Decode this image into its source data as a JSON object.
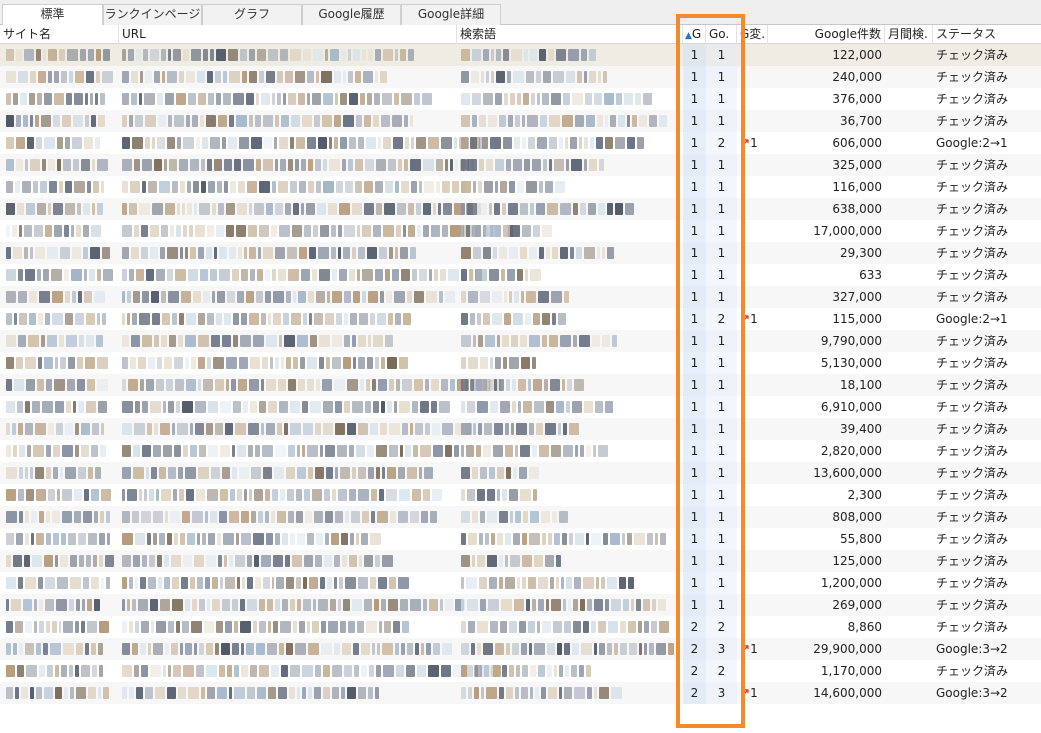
{
  "tabs": [
    {
      "label": "標準",
      "active": true
    },
    {
      "label": "ランクインページ",
      "active": false
    },
    {
      "label": "グラフ",
      "active": false
    },
    {
      "label": "Google履歴",
      "active": false
    },
    {
      "label": "Google詳細",
      "active": false
    }
  ],
  "columns": {
    "site_name": "サイト名",
    "url": "URL",
    "keyword": "検索語",
    "g": "G",
    "go": "Go.",
    "change": "G変.",
    "google_count": "Google件数",
    "monthly": "月間検.",
    "status": "ステータス"
  },
  "sort_icon": "sort-ascending-icon",
  "highlight_color": "#f28a2e",
  "rows": [
    {
      "g": "1",
      "go": "1",
      "chg": "",
      "count": "122,000",
      "status": "チェック済み"
    },
    {
      "g": "1",
      "go": "1",
      "chg": "",
      "count": "240,000",
      "status": "チェック済み"
    },
    {
      "g": "1",
      "go": "1",
      "chg": "",
      "count": "376,000",
      "status": "チェック済み"
    },
    {
      "g": "1",
      "go": "1",
      "chg": "",
      "count": "36,700",
      "status": "チェック済み"
    },
    {
      "g": "1",
      "go": "2",
      "chg": "1",
      "count": "606,000",
      "status": "Google:2→1"
    },
    {
      "g": "1",
      "go": "1",
      "chg": "",
      "count": "325,000",
      "status": "チェック済み"
    },
    {
      "g": "1",
      "go": "1",
      "chg": "",
      "count": "116,000",
      "status": "チェック済み"
    },
    {
      "g": "1",
      "go": "1",
      "chg": "",
      "count": "638,000",
      "status": "チェック済み"
    },
    {
      "g": "1",
      "go": "1",
      "chg": "",
      "count": "17,000,000",
      "status": "チェック済み"
    },
    {
      "g": "1",
      "go": "1",
      "chg": "",
      "count": "29,300",
      "status": "チェック済み"
    },
    {
      "g": "1",
      "go": "1",
      "chg": "",
      "count": "633",
      "status": "チェック済み"
    },
    {
      "g": "1",
      "go": "1",
      "chg": "",
      "count": "327,000",
      "status": "チェック済み"
    },
    {
      "g": "1",
      "go": "2",
      "chg": "1",
      "count": "115,000",
      "status": "Google:2→1"
    },
    {
      "g": "1",
      "go": "1",
      "chg": "",
      "count": "9,790,000",
      "status": "チェック済み"
    },
    {
      "g": "1",
      "go": "1",
      "chg": "",
      "count": "5,130,000",
      "status": "チェック済み"
    },
    {
      "g": "1",
      "go": "1",
      "chg": "",
      "count": "18,100",
      "status": "チェック済み"
    },
    {
      "g": "1",
      "go": "1",
      "chg": "",
      "count": "6,910,000",
      "status": "チェック済み"
    },
    {
      "g": "1",
      "go": "1",
      "chg": "",
      "count": "39,400",
      "status": "チェック済み"
    },
    {
      "g": "1",
      "go": "1",
      "chg": "",
      "count": "2,820,000",
      "status": "チェック済み"
    },
    {
      "g": "1",
      "go": "1",
      "chg": "",
      "count": "13,600,000",
      "status": "チェック済み"
    },
    {
      "g": "1",
      "go": "1",
      "chg": "",
      "count": "2,300",
      "status": "チェック済み"
    },
    {
      "g": "1",
      "go": "1",
      "chg": "",
      "count": "808,000",
      "status": "チェック済み"
    },
    {
      "g": "1",
      "go": "1",
      "chg": "",
      "count": "55,800",
      "status": "チェック済み"
    },
    {
      "g": "1",
      "go": "1",
      "chg": "",
      "count": "125,000",
      "status": "チェック済み"
    },
    {
      "g": "1",
      "go": "1",
      "chg": "",
      "count": "1,200,000",
      "status": "チェック済み"
    },
    {
      "g": "1",
      "go": "1",
      "chg": "",
      "count": "269,000",
      "status": "チェック済み"
    },
    {
      "g": "2",
      "go": "2",
      "chg": "",
      "count": "8,860",
      "status": "チェック済み"
    },
    {
      "g": "2",
      "go": "3",
      "chg": "1",
      "count": "29,900,000",
      "status": "Google:3→2"
    },
    {
      "g": "2",
      "go": "2",
      "chg": "",
      "count": "1,170,000",
      "status": "チェック済み"
    },
    {
      "g": "2",
      "go": "3",
      "chg": "1",
      "count": "14,600,000",
      "status": "Google:3→2"
    }
  ]
}
